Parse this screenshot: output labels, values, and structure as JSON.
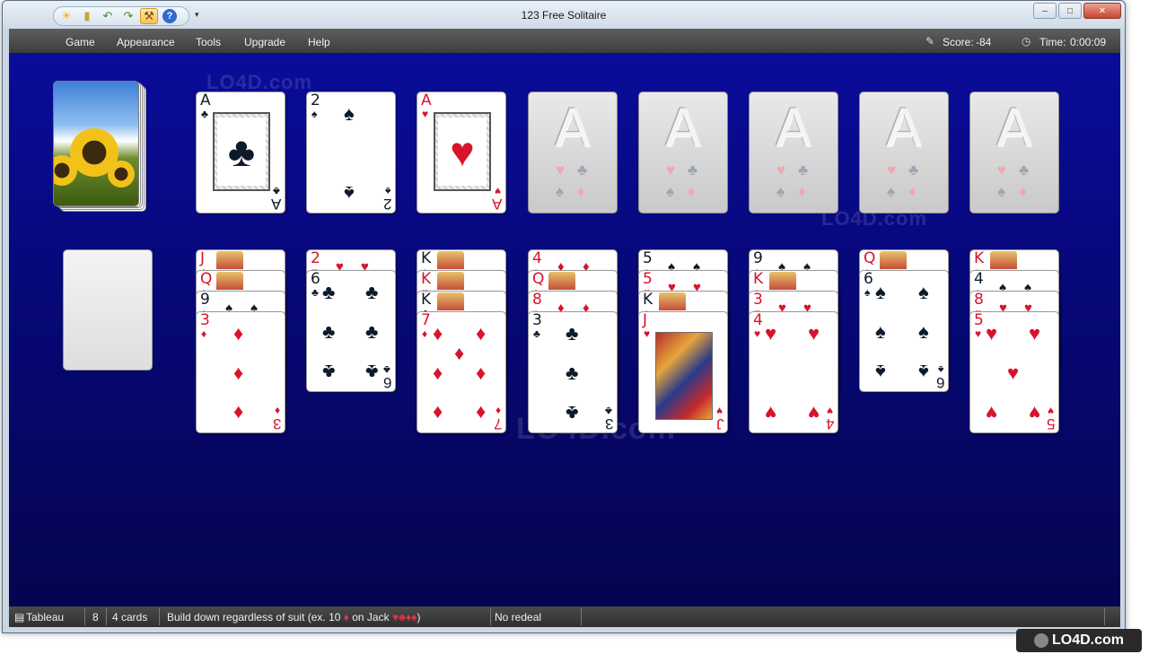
{
  "window": {
    "title": "123 Free Solitaire",
    "controls": {
      "minimize": "–",
      "maximize": "□",
      "close": "✕"
    }
  },
  "quick_access": [
    "sun-icon",
    "book-icon",
    "undo-icon",
    "redo-icon",
    "hammer-icon",
    "help-icon"
  ],
  "menu": {
    "items": [
      "Game",
      "Appearance",
      "Tools",
      "Upgrade",
      "Help"
    ],
    "score_label": "Score:",
    "score_value": "-84",
    "time_label": "Time:",
    "time_value": "0:00:09"
  },
  "board": {
    "foundation_row": [
      {
        "rank": "A",
        "suit": "♣",
        "color": "black",
        "kind": "ace"
      },
      {
        "rank": "2",
        "suit": "♠",
        "color": "black",
        "kind": "pips"
      },
      {
        "rank": "A",
        "suit": "♥",
        "color": "red",
        "kind": "ace"
      },
      {
        "rank": "A",
        "kind": "empty"
      },
      {
        "rank": "A",
        "kind": "empty"
      },
      {
        "rank": "A",
        "kind": "empty"
      },
      {
        "rank": "A",
        "kind": "empty"
      },
      {
        "rank": "A",
        "kind": "empty"
      }
    ],
    "tableau": [
      {
        "stubs": [
          {
            "rank": "J",
            "suit": "♦",
            "color": "red"
          },
          {
            "rank": "Q",
            "suit": "♦",
            "color": "red"
          },
          {
            "rank": "9",
            "suit": "♠",
            "color": "black"
          }
        ],
        "top": {
          "rank": "3",
          "suit": "♦",
          "color": "red"
        }
      },
      {
        "stubs": [
          {
            "rank": "2",
            "suit": "♥",
            "color": "red"
          }
        ],
        "top": {
          "rank": "6",
          "suit": "♣",
          "color": "black"
        }
      },
      {
        "stubs": [
          {
            "rank": "K",
            "suit": "♠",
            "color": "black"
          },
          {
            "rank": "K",
            "suit": "♥",
            "color": "red"
          },
          {
            "rank": "K",
            "suit": "♣",
            "color": "black"
          }
        ],
        "top": {
          "rank": "7",
          "suit": "♦",
          "color": "red"
        }
      },
      {
        "stubs": [
          {
            "rank": "4",
            "suit": "♦",
            "color": "red"
          },
          {
            "rank": "Q",
            "suit": "♦",
            "color": "red"
          },
          {
            "rank": "8",
            "suit": "♦",
            "color": "red"
          }
        ],
        "top": {
          "rank": "3",
          "suit": "♣",
          "color": "black"
        }
      },
      {
        "stubs": [
          {
            "rank": "5",
            "suit": "♠",
            "color": "black"
          },
          {
            "rank": "5",
            "suit": "♥",
            "color": "red"
          },
          {
            "rank": "K",
            "suit": "♠",
            "color": "black"
          }
        ],
        "top": {
          "rank": "J",
          "suit": "♥",
          "color": "red"
        }
      },
      {
        "stubs": [
          {
            "rank": "9",
            "suit": "♠",
            "color": "black"
          },
          {
            "rank": "K",
            "suit": "♦",
            "color": "red"
          },
          {
            "rank": "3",
            "suit": "♥",
            "color": "red"
          }
        ],
        "top": {
          "rank": "4",
          "suit": "♥",
          "color": "red"
        }
      },
      {
        "stubs": [
          {
            "rank": "Q",
            "suit": "♦",
            "color": "red"
          }
        ],
        "top": {
          "rank": "6",
          "suit": "♠",
          "color": "black"
        }
      },
      {
        "stubs": [
          {
            "rank": "K",
            "suit": "♦",
            "color": "red"
          },
          {
            "rank": "4",
            "suit": "♠",
            "color": "black"
          },
          {
            "rank": "8",
            "suit": "♥",
            "color": "red"
          }
        ],
        "top": {
          "rank": "5",
          "suit": "♥",
          "color": "red"
        }
      }
    ],
    "watermark": "LO4D.com"
  },
  "statusbar": {
    "area": "Tableau",
    "count": "8",
    "cards": "4 cards",
    "rule_prefix": "Build down regardless of suit (ex. 10",
    "rule_suit1": "♦",
    "rule_mid": "on Jack",
    "rule_suits": "♥♣♦♠",
    "rule_end": ")",
    "redeal": "No redeal"
  },
  "badge": "LO4D.com",
  "colors": {
    "board_top": "#0a0c9a",
    "board_bottom": "#04054f",
    "red_suit": "#d8132a"
  }
}
